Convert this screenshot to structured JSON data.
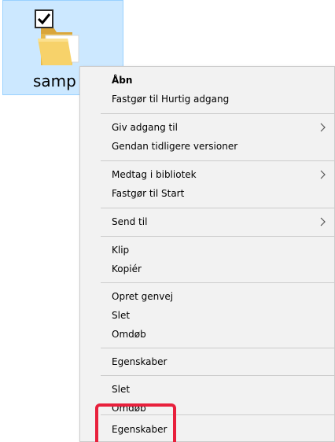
{
  "file": {
    "name": "samp",
    "checked": true,
    "icon": "folder-icon"
  },
  "context_menu": {
    "items": [
      {
        "label": "Åbn",
        "bold": true,
        "submenu": false
      },
      {
        "label": "Fastgør til Hurtig adgang",
        "bold": false,
        "submenu": false
      },
      {
        "label": "Giv adgang til",
        "bold": false,
        "submenu": true
      },
      {
        "label": "Gendan tidligere versioner",
        "bold": false,
        "submenu": false
      },
      {
        "label": "Medtag i bibliotek",
        "bold": false,
        "submenu": true
      },
      {
        "label": "Fastgør til Start",
        "bold": false,
        "submenu": false
      },
      {
        "label": "Send til",
        "bold": false,
        "submenu": true
      },
      {
        "label": "Klip",
        "bold": false,
        "submenu": false
      },
      {
        "label": "Kopiér",
        "bold": false,
        "submenu": false
      },
      {
        "label": "Opret genvej",
        "bold": false,
        "submenu": false
      },
      {
        "label": "Slet",
        "bold": false,
        "submenu": false
      },
      {
        "label": "Omdøb",
        "bold": false,
        "submenu": false
      },
      {
        "label": "Egenskaber",
        "bold": false,
        "submenu": false
      },
      {
        "label": "Slet",
        "bold": false,
        "submenu": false
      },
      {
        "label": "Omdøb",
        "bold": false,
        "submenu": false
      },
      {
        "label": "Egenskaber",
        "bold": false,
        "submenu": false
      }
    ],
    "submenu_arrow_icon": "chevron-right-icon"
  },
  "colors": {
    "selection_bg": "#cce8ff",
    "menu_bg": "#f2f2f2",
    "highlight": "#e8203c"
  }
}
